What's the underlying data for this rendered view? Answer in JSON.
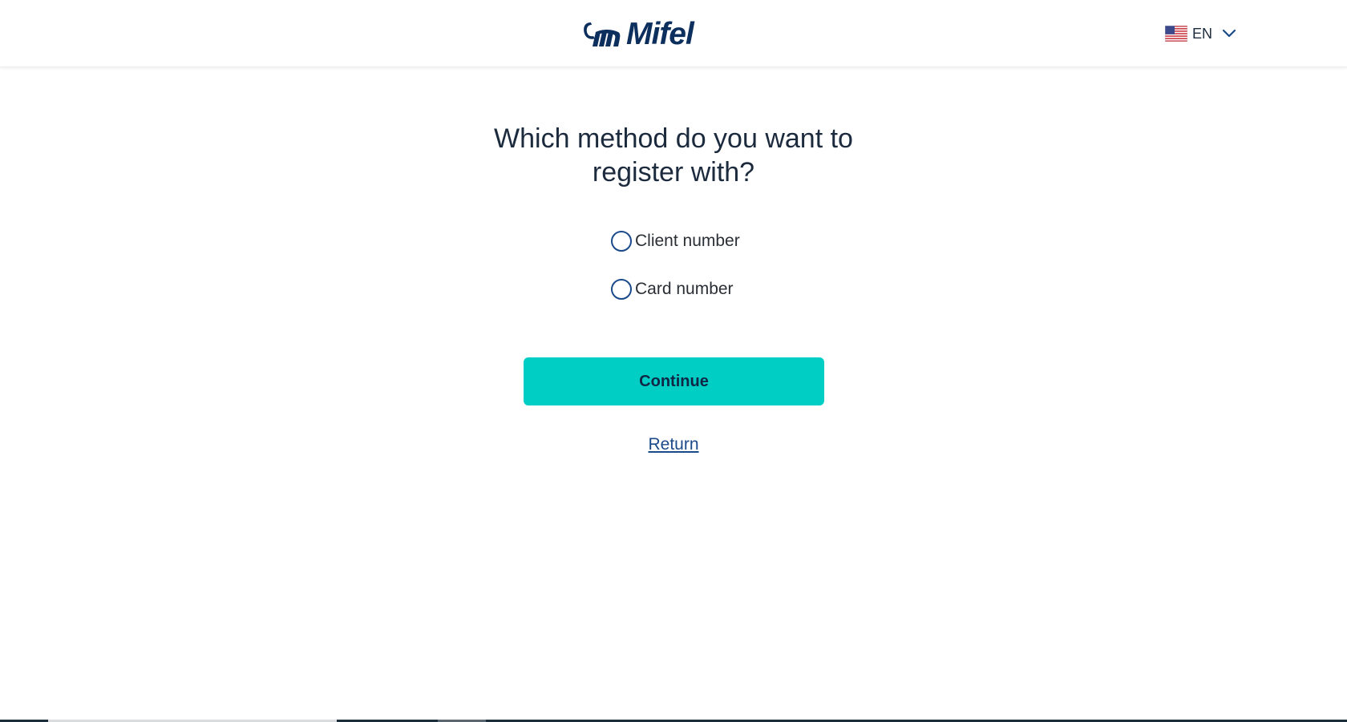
{
  "header": {
    "logo_text": "Mifel",
    "language": {
      "code": "EN",
      "flag_icon": "us-flag-icon",
      "dropdown_icon": "chevron-down-icon"
    }
  },
  "main": {
    "title": "Which method do you want to register with?",
    "options": [
      {
        "label": "Client number",
        "selected": false
      },
      {
        "label": "Card number",
        "selected": false
      }
    ],
    "continue_label": "Continue",
    "return_label": "Return"
  },
  "colors": {
    "brand_navy": "#0d2f5e",
    "button_teal": "#00cdc4",
    "link_blue": "#1b4a8a",
    "text_dark": "#1c2a3d"
  }
}
